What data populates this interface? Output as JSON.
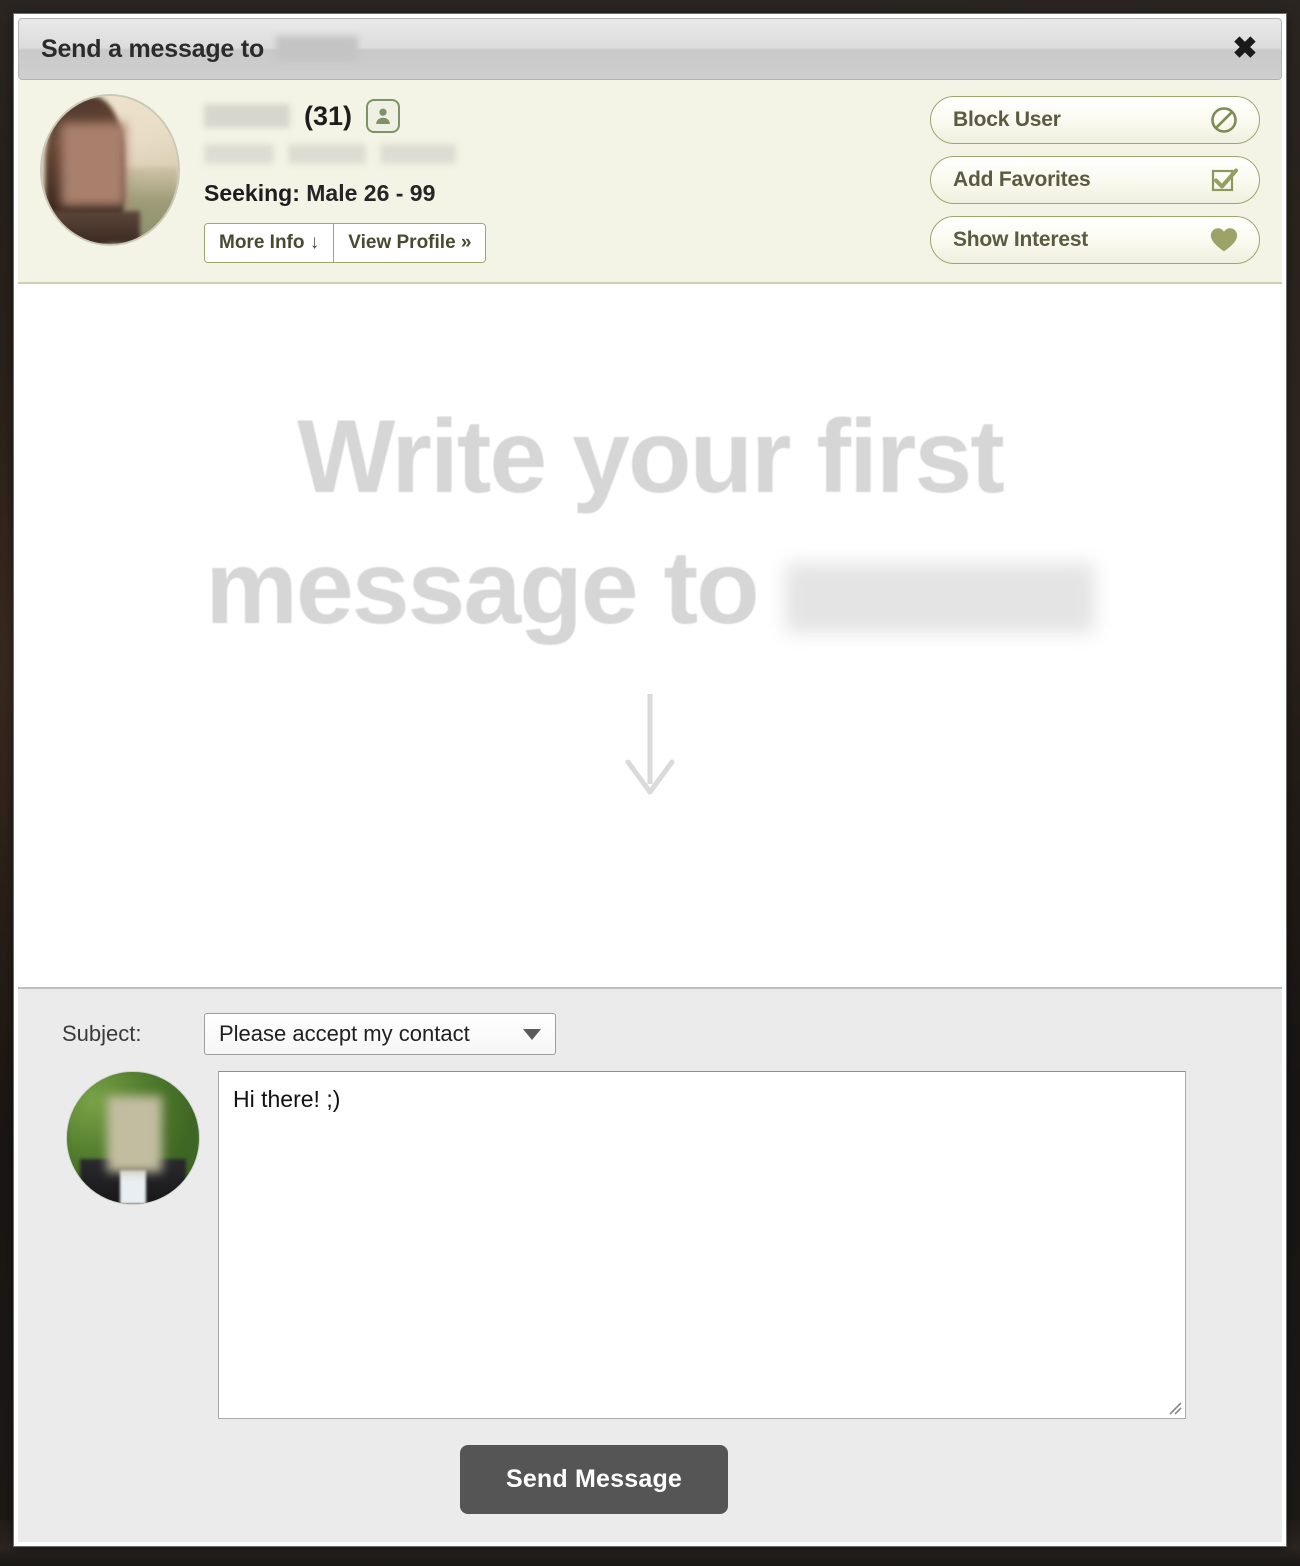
{
  "dialog": {
    "title_prefix": "Send a message to",
    "title_name_redacted": "",
    "close_icon": "close-icon"
  },
  "profile": {
    "name_redacted": "",
    "age": "(31)",
    "verified_badge_icon": "person-badge-icon",
    "city_redacted": "",
    "region_redacted": "",
    "country_redacted": "",
    "seeking_label": "Seeking:",
    "seeking_value": "Male 26 - 99",
    "more_info_label": "More Info ↓",
    "view_profile_label": "View Profile »",
    "avatar_alt": "profile-photo"
  },
  "actions": [
    {
      "label": "Block User",
      "icon": "block-icon"
    },
    {
      "label": "Add Favorites",
      "icon": "checkbox-check-icon"
    },
    {
      "label": "Show Interest",
      "icon": "heart-icon"
    }
  ],
  "watermark": {
    "line1": "Write your first",
    "line2": "message to",
    "name_redacted": "",
    "arrow_icon": "arrow-down-icon"
  },
  "compose": {
    "subject_label": "Subject:",
    "subject_value": "Please accept my contact",
    "subject_options": [
      "Please accept my contact"
    ],
    "message_value": "Hi there! ;)",
    "message_placeholder": "",
    "sender_avatar_alt": "sender-photo",
    "send_label": "Send Message",
    "resize_icon": "resize-grip-icon"
  },
  "colors": {
    "header_band": "#f4f4e6",
    "accent_olive": "#9aa86f",
    "button_text": "#5a5b40",
    "send_button": "#555555",
    "watermark_text": "#d6d6d6",
    "compose_bg": "#ebebeb"
  },
  "background": {
    "left_text": "      ",
    "right_text": "      "
  }
}
